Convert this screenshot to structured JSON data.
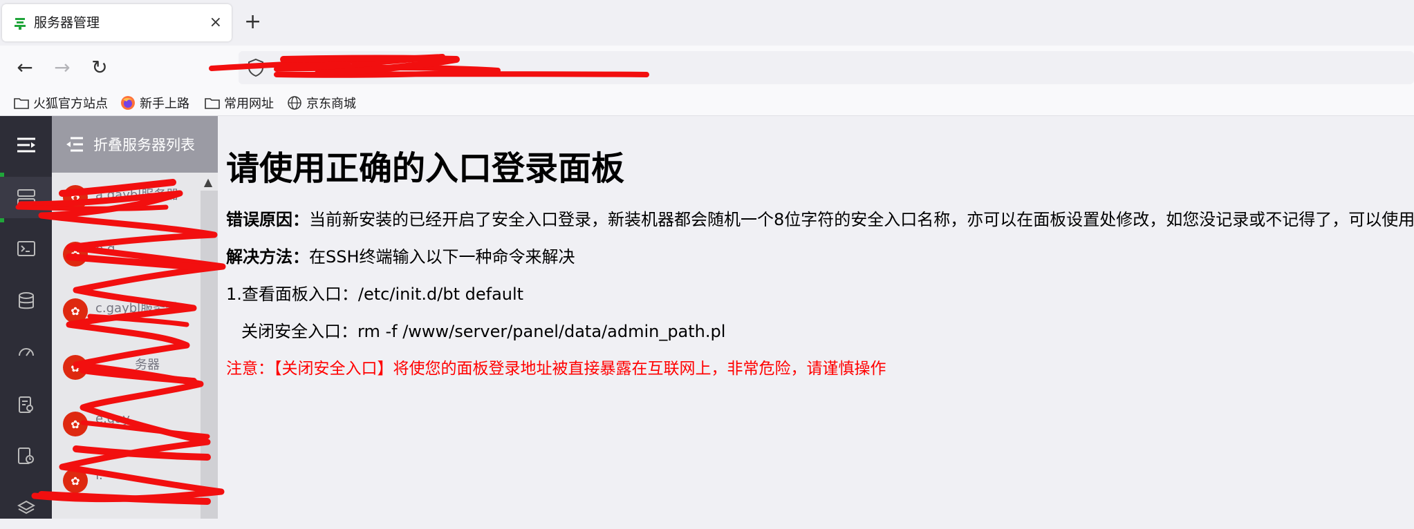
{
  "browser": {
    "tab_title": "服务器管理",
    "new_tab_label": "+",
    "close_label": "×",
    "back_label": "←",
    "forward_label": "→",
    "reload_label": "↻"
  },
  "bookmarks": [
    {
      "label": "火狐官方站点",
      "icon": "folder-icon"
    },
    {
      "label": "新手上路",
      "icon": "firefox-icon"
    },
    {
      "label": "常用网址",
      "icon": "folder-icon"
    },
    {
      "label": "京东商城",
      "icon": "globe-icon"
    }
  ],
  "server_panel": {
    "collapse_label": "折叠服务器列表",
    "servers": [
      {
        "name": "a.gaybl服务器"
      },
      {
        "name": "b.g"
      },
      {
        "name": "c.gaybl服务器"
      },
      {
        "name": "务器"
      },
      {
        "name": "e.gay"
      },
      {
        "name": "f."
      }
    ]
  },
  "main": {
    "title": "请使用正确的入口登录面板",
    "reason_label": "错误原因：",
    "reason_text": "当前新安装的已经开启了安全入口登录，新装机器都会随机一个8位字符的安全入口名称，亦可以在面板设置处修改，如您没记录或不记得了，可以使用",
    "solution_label": "解决方法：",
    "solution_text": "在SSH终端输入以下一种命令来解决",
    "step1": "1.查看面板入口：/etc/init.d/bt default",
    "step2": "关闭安全入口：rm -f /www/server/panel/data/admin_path.pl",
    "warning": "注意：【关闭安全入口】将使您的面板登录地址被直接暴露在互联网上，非常危险，请谨慎操作"
  },
  "colors": {
    "accent_green": "#20a53a",
    "warning_red": "#ff0000",
    "scribble_red": "#f20f0f"
  }
}
